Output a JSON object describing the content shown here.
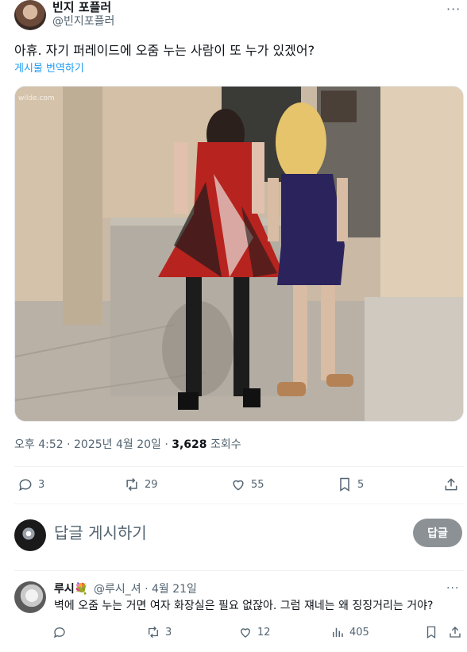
{
  "post": {
    "author_name": "빈지 포플러",
    "author_handle": "@빈지포플러",
    "more_icon": "more-horizontal-icon",
    "text": "아휴. 자기 퍼레이드에 오줌 누는 사람이 또 누가 있겠어?",
    "translate_label": "게시물 번역하기",
    "image_watermark": "wilde.com",
    "time": "오후 4:52 · 2025년 4월 20일 · ",
    "views_count": "3,628",
    "views_label": " 조회수",
    "actions": {
      "replies": "3",
      "reposts": "29",
      "likes": "55",
      "bookmarks": "5"
    }
  },
  "reply_box": {
    "placeholder": "답글 게시하기",
    "button_label": "답글"
  },
  "comment": {
    "author_name": "루시💐",
    "author_handle": "@루시_셔 · 4월 21일",
    "text": "벽에 오줌 누는 거면 여자 화장실은 필요 없잖아. 그럼 쟤네는 왜 징징거리는 거야?",
    "actions": {
      "replies": "",
      "reposts": "3",
      "likes": "12",
      "views": "405"
    }
  },
  "colors": {
    "accent": "#1d9bf0",
    "secondary_text": "#536471",
    "reply_button": "#8c9196"
  }
}
